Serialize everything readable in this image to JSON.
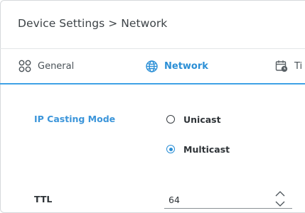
{
  "breadcrumb": "Device Settings > Network",
  "tabs": [
    {
      "label": "General",
      "icon": "grid-icon"
    },
    {
      "label": "Network",
      "icon": "globe-icon",
      "active": true
    },
    {
      "label": "Ti",
      "icon": "calendar-clock-icon"
    }
  ],
  "ip_casting": {
    "label": "IP Casting Mode",
    "options": [
      "Unicast",
      "Multicast"
    ],
    "selected": "Multicast"
  },
  "ttl": {
    "label": "TTL",
    "value": "64"
  },
  "colors": {
    "accent": "#2b8fd6",
    "tab_underline": "#3fa2e6",
    "section_label": "#3b95da",
    "text": "#2f3438"
  }
}
